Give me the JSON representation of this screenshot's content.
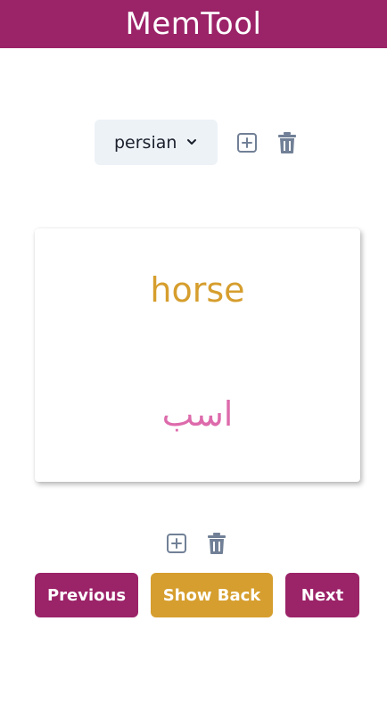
{
  "app": {
    "title": "MemTool"
  },
  "deck": {
    "selected": "persian",
    "add_icon": "plus-square-icon",
    "delete_icon": "trash-icon"
  },
  "card": {
    "front": "horse",
    "back": "اسب",
    "add_icon": "plus-square-icon",
    "delete_icon": "trash-icon"
  },
  "buttons": {
    "previous": "Previous",
    "show_back": "Show Back",
    "next": "Next"
  },
  "colors": {
    "brand": "#9b2368",
    "accent": "#d69e2e",
    "back_text": "#dd6bac",
    "select_bg": "#edf2f7",
    "icon": "#718096"
  }
}
